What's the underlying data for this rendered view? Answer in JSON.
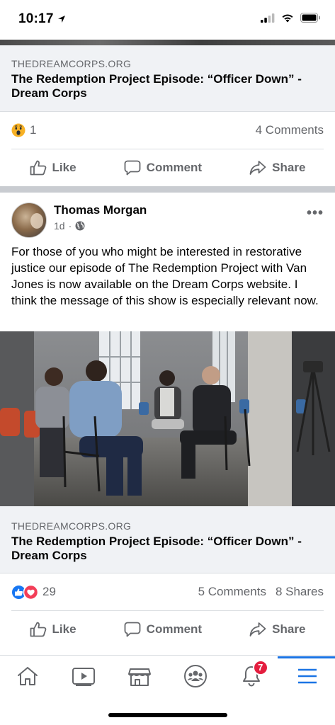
{
  "status_bar": {
    "time": "10:17"
  },
  "previous_post": {
    "link_domain": "THEDREAMCORPS.ORG",
    "link_title": "The Redemption Project Episode: “Officer Down” - Dream Corps",
    "reaction_count": "1",
    "comments": "4 Comments",
    "actions": {
      "like": "Like",
      "comment": "Comment",
      "share": "Share"
    }
  },
  "post": {
    "author": "Thomas Morgan",
    "time": "1d",
    "more": "•••",
    "text": "For those of you who might be interested in restorative justice our episode of The Redemption Project with Van Jones is now available on the Dream Corps website.  I think the message of this show is especially relevant now.",
    "link_domain": "THEDREAMCORPS.ORG",
    "link_title": "The Redemption Project Episode: “Officer Down” - Dream Corps",
    "reaction_count": "29",
    "comments": "5 Comments",
    "shares": "8 Shares",
    "actions": {
      "like": "Like",
      "comment": "Comment",
      "share": "Share"
    }
  },
  "nav": {
    "items": [
      "home-icon",
      "watch-icon",
      "marketplace-icon",
      "groups-icon",
      "notifications-icon",
      "menu-icon"
    ],
    "notification_badge": "7",
    "active": "menu-icon"
  },
  "colors": {
    "accent": "#1b74e4",
    "badge": "#e41e3f",
    "muted": "#65676b",
    "like_blue": "#1877f2",
    "love_red": "#f33e58"
  }
}
